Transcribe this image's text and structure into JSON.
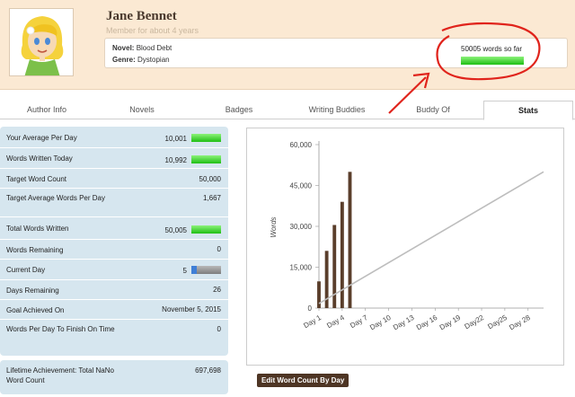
{
  "profile": {
    "name": "Jane Bennet",
    "member": "Member for about 4 years",
    "novel_label": "Novel:",
    "novel": "Blood Debt",
    "genre_label": "Genre:",
    "genre": "Dystopian",
    "words_so_far": "50005 words so far",
    "progress": 1.0
  },
  "tabs": [
    {
      "label": "Author Info",
      "active": false
    },
    {
      "label": "Novels",
      "active": false
    },
    {
      "label": "Badges",
      "active": false
    },
    {
      "label": "Writing Buddies",
      "active": false
    },
    {
      "label": "Buddy Of",
      "active": false
    },
    {
      "label": "Stats",
      "active": true
    }
  ],
  "stats": [
    {
      "label": "Your Average Per Day",
      "value": "10,001",
      "bar": "green",
      "level": 1.0
    },
    {
      "label": "Words Written Today",
      "value": "10,992",
      "bar": "green",
      "level": 1.0
    },
    {
      "label": "Target Word Count",
      "value": "50,000"
    },
    {
      "label": "Target Average Words Per Day",
      "value": "1,667"
    },
    {
      "label": "Total Words Written",
      "value": "50,005",
      "bar": "green",
      "level": 1.0
    },
    {
      "label": "Words Remaining",
      "value": "0"
    },
    {
      "label": "Current Day",
      "value": "5",
      "bar": "gray",
      "level": 0.17
    },
    {
      "label": "Days Remaining",
      "value": "26"
    },
    {
      "label": "Goal Achieved On",
      "value": "November 5, 2015"
    },
    {
      "label": "Words Per Day To Finish On Time",
      "value": "0"
    }
  ],
  "lifetime": {
    "label": "Lifetime Achievement: Total NaNo Word Count",
    "value": "697,698"
  },
  "edit_button": "Edit Word Count By Day",
  "colors": {
    "header_bg": "#fbe9d3",
    "panel_bg": "#d6e6ef",
    "bar_fill": "#5a3e2b",
    "target_line": "#bdbdbd",
    "progress_green": "#1fbf14",
    "annotation_red": "#e0241c"
  },
  "chart_data": {
    "type": "bar",
    "ylabel": "Words",
    "ylim": [
      0,
      60000
    ],
    "yticks": [
      "0",
      "15,000",
      "30,000",
      "45,000",
      "60,000"
    ],
    "ytick_values": [
      0,
      15000,
      30000,
      45000,
      60000
    ],
    "xlim": [
      1,
      30
    ],
    "xticks": [
      "Day 1",
      "Day 4",
      "Day 7",
      "Day 10",
      "Day 13",
      "Day 16",
      "Day 19",
      "Day22",
      "Day25",
      "Day 28"
    ],
    "xtick_values": [
      1,
      4,
      7,
      10,
      13,
      16,
      19,
      22,
      25,
      28
    ],
    "bars": {
      "days": [
        1,
        2,
        3,
        4,
        5
      ],
      "values": [
        9800,
        21000,
        30500,
        39000,
        50005
      ]
    },
    "target_line": {
      "x": [
        1,
        30
      ],
      "y": [
        1667,
        50000
      ]
    }
  }
}
